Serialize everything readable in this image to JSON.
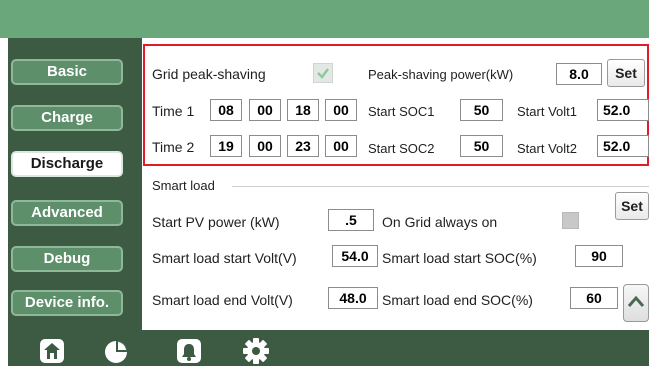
{
  "sidebar": {
    "items": [
      {
        "label": "Basic"
      },
      {
        "label": "Charge"
      },
      {
        "label": "Discharge"
      },
      {
        "label": "Advanced"
      },
      {
        "label": "Debug"
      },
      {
        "label": "Device info."
      }
    ]
  },
  "peak_shaving": {
    "grid_label": "Grid peak-shaving",
    "grid_checked": true,
    "power_label": "Peak-shaving power(kW)",
    "power_value": "8.0",
    "set_label": "Set"
  },
  "time1": {
    "label": "Time 1",
    "start_h": "08",
    "start_m": "00",
    "end_h": "18",
    "end_m": "00",
    "soc_label": "Start SOC1",
    "soc_value": "50",
    "volt_label": "Start Volt1",
    "volt_value": "52.0"
  },
  "time2": {
    "label": "Time 2",
    "start_h": "19",
    "start_m": "00",
    "end_h": "23",
    "end_m": "00",
    "soc_label": "Start SOC2",
    "soc_value": "50",
    "volt_label": "Start Volt2",
    "volt_value": "52.0"
  },
  "smart_load": {
    "section_label": "Smart load",
    "set_label": "Set",
    "pv_label": "Start PV power (kW)",
    "pv_value": ".5",
    "on_grid_label": "On Grid always on",
    "start_volt_label": "Smart load start Volt(V)",
    "start_volt_value": "54.0",
    "start_soc_label": "Smart load start SOC(%)",
    "start_soc_value": "90",
    "end_volt_label": "Smart load end Volt(V)",
    "end_volt_value": "48.0",
    "end_soc_label": "Smart load end SOC(%)",
    "end_soc_value": "60"
  },
  "colors": {
    "top_bar": "#6aa87c",
    "sidebar_bg": "#3d5a43",
    "nav_button": "#5d8f6b",
    "highlight_box": "#e01b2a"
  },
  "bottom_nav": [
    "home-icon",
    "pie-chart-icon",
    "bell-icon",
    "gear-icon"
  ]
}
